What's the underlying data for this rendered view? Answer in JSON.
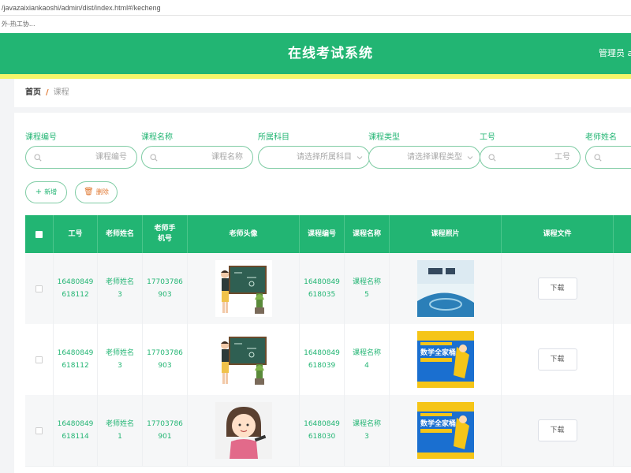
{
  "browser": {
    "url": "/javazaixiankaoshi/admin/dist/index.html#/kecheng",
    "bookmark": "外-热工协..."
  },
  "header": {
    "title": "在线考试系统",
    "user_label": "管理员 a"
  },
  "breadcrumb": {
    "home": "首页",
    "separator": "/",
    "current": "课程"
  },
  "filters": [
    {
      "label": "课程编号",
      "placeholder": "课程编号",
      "type": "text"
    },
    {
      "label": "课程名称",
      "placeholder": "课程名称",
      "type": "text"
    },
    {
      "label": "所属科目",
      "placeholder": "请选择所属科目",
      "type": "select"
    },
    {
      "label": "课程类型",
      "placeholder": "请选择课程类型",
      "type": "select"
    },
    {
      "label": "工号",
      "placeholder": "工号",
      "type": "text"
    },
    {
      "label": "老师姓名",
      "placeholder": "",
      "type": "text"
    }
  ],
  "actions": {
    "add_label": "新增",
    "add_glyph": "+",
    "delete_label": "删除",
    "delete_glyph": "🗑"
  },
  "table": {
    "columns": [
      "",
      "工号",
      "老师姓名",
      "老师手机号",
      "老师头像",
      "课程编号",
      "课程名称",
      "课程照片",
      "课程文件",
      ""
    ],
    "download_label": "下载",
    "rows": [
      {
        "job_no": "16480849618112",
        "teacher_name": "老师姓名3",
        "phone": "17703786903",
        "avatar": "teacher-at-board",
        "course_no": "16480849618035",
        "course_name": "课程名称5",
        "photo": "physics-book-cover"
      },
      {
        "job_no": "16480849618112",
        "teacher_name": "老师姓名3",
        "phone": "17703786903",
        "avatar": "teacher-at-board",
        "course_no": "16480849618039",
        "course_name": "课程名称4",
        "photo": "math-book-cover",
        "photo_title": "数学全家桶"
      },
      {
        "job_no": "16480849618114",
        "teacher_name": "老师姓名1",
        "phone": "17703786901",
        "avatar": "teacher-cartoon-girl",
        "course_no": "16480849618030",
        "course_name": "课程名称3",
        "photo": "math-book-cover",
        "photo_title": "数学全家桶"
      }
    ]
  },
  "colors": {
    "primary": "#22b573",
    "accent_yellow": "#f5f56a",
    "danger": "#e0762f"
  }
}
